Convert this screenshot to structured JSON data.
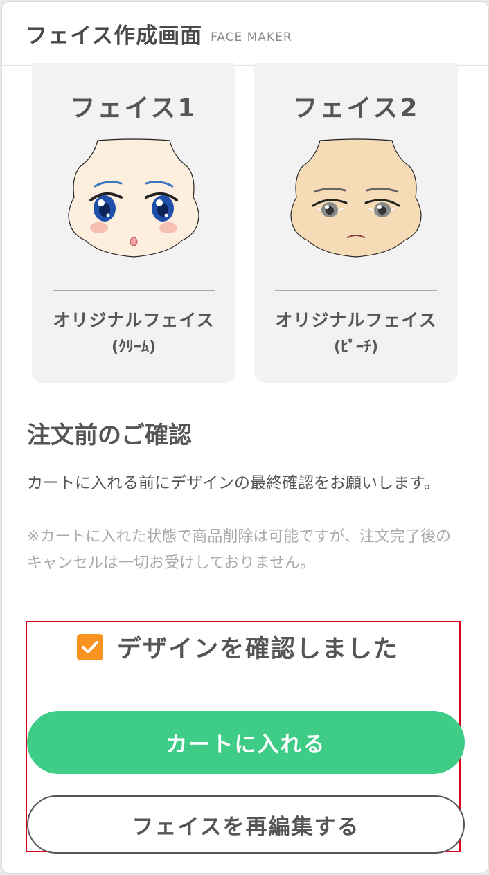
{
  "header": {
    "title": "フェイス作成画面",
    "subtitle": "FACE MAKER"
  },
  "faces": [
    {
      "title": "フェイス1",
      "name": "オリジナルフェイス",
      "variant": "(ｸﾘｰﾑ)",
      "skin_color": "#fdeedd",
      "icon": "face-1-icon"
    },
    {
      "title": "フェイス2",
      "name": "オリジナルフェイス",
      "variant": "(ﾋﾟｰﾁ)",
      "skin_color": "#f6dcb6",
      "icon": "face-2-icon"
    }
  ],
  "confirm": {
    "title": "注文前のご確認",
    "description": "カートに入れる前にデザインの最終確認をお願いします。",
    "note": "※カートに入れた状態で商品削除は可能ですが、注文完了後のキャンセルは一切お受けしておりません。"
  },
  "actions": {
    "checkbox_label": "デザインを確認しました",
    "checkbox_checked": true,
    "checkbox_color": "#f7931e",
    "cart_button": "カートに入れる",
    "cart_color": "#3ecc86",
    "edit_button": "フェイスを再編集する",
    "highlight_color": "#d9001b"
  }
}
